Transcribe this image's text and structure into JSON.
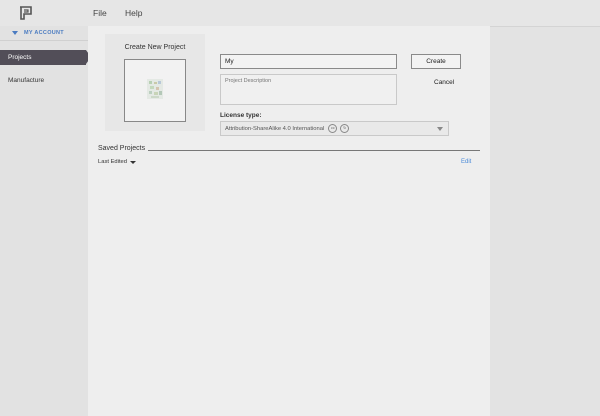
{
  "menu": {
    "file": "File",
    "help": "Help"
  },
  "sidebar": {
    "account": "MY ACCOUNT",
    "items": [
      {
        "label": "Projects",
        "active": true
      },
      {
        "label": "Manufacture",
        "active": false
      }
    ]
  },
  "create": {
    "title": "Create New Project",
    "name_value": "My",
    "description_placeholder": "Project Description",
    "create_label": "Create",
    "cancel_label": "Cancel"
  },
  "license": {
    "label": "License type:",
    "selected": "Attribution-ShareAlike 4.0 International",
    "icons": [
      "cc-by-icon",
      "cc-sa-icon"
    ]
  },
  "saved": {
    "title": "Saved Projects",
    "sort": "Last Edited",
    "edit": "Edit"
  },
  "colors": {
    "accent": "#4a7bc1",
    "nav_active": "#524e58",
    "link": "#4a8ad8"
  }
}
